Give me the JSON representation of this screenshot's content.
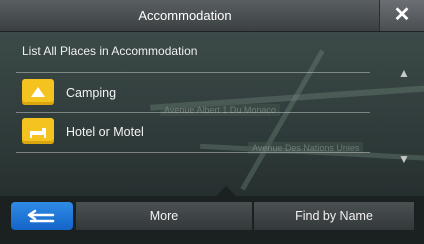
{
  "header": {
    "title": "Accommodation",
    "close_icon": "close-icon"
  },
  "list": {
    "heading": "List All Places in Accommodation",
    "items": [
      {
        "label": "Camping",
        "icon": "camping-icon"
      },
      {
        "label": "Hotel or Motel",
        "icon": "hotel-icon"
      }
    ]
  },
  "map_labels": [
    "Avenue Albert 1 Du Monaco",
    "Avenue Des Nations Unies"
  ],
  "footer": {
    "back_icon": "back-icon",
    "more_label": "More",
    "find_label": "Find by Name"
  },
  "colors": {
    "folder": "#f4c320",
    "back_button": "#1f78d8"
  }
}
